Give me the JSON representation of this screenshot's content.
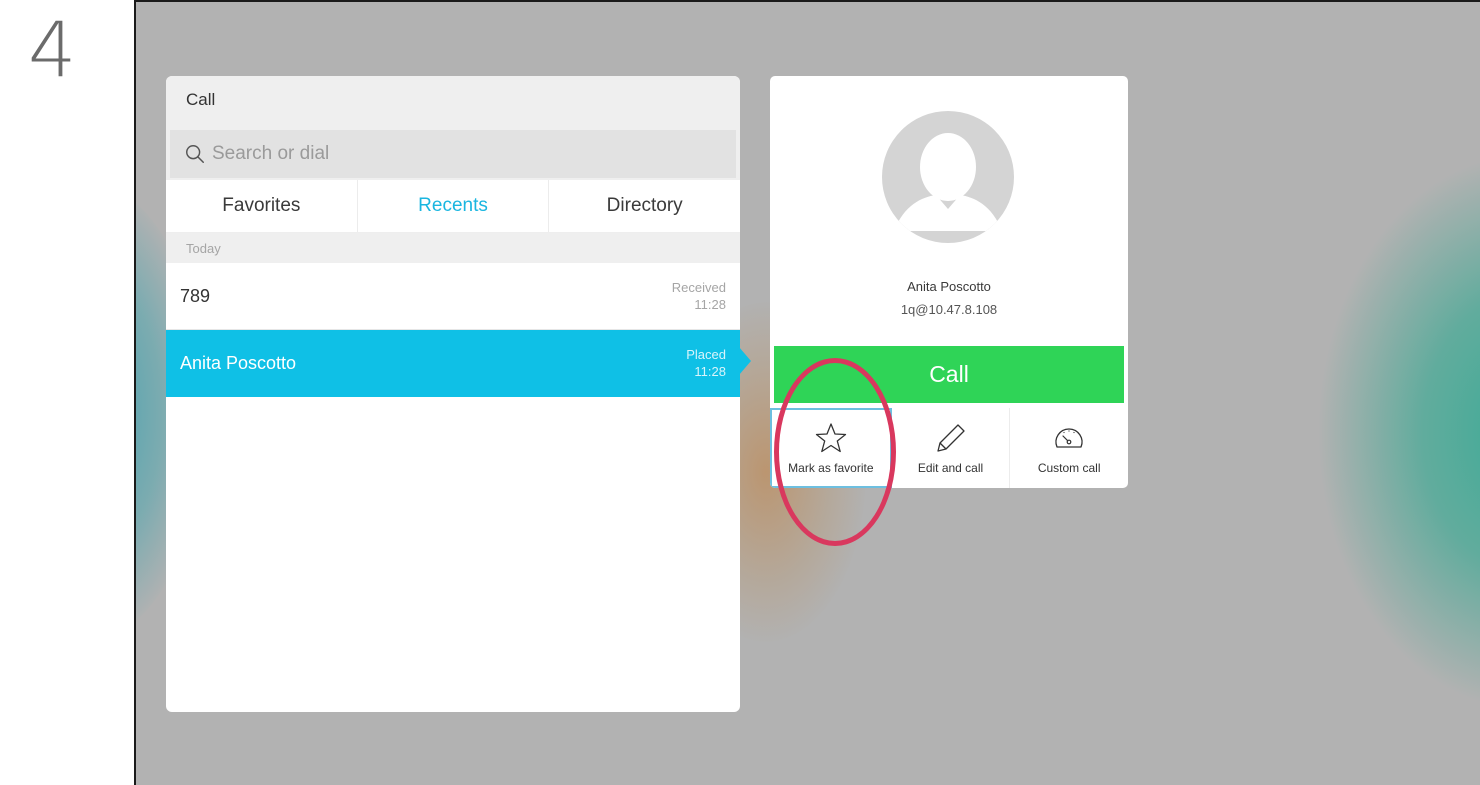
{
  "step": {
    "number": "4"
  },
  "call_panel": {
    "title": "Call",
    "search": {
      "placeholder": "Search or dial"
    },
    "tabs": [
      {
        "label": "Favorites",
        "active": false
      },
      {
        "label": "Recents",
        "active": true
      },
      {
        "label": "Directory",
        "active": false
      }
    ],
    "section": "Today",
    "recents": [
      {
        "name": "789",
        "status": "Received",
        "time": "11:28",
        "selected": false
      },
      {
        "name": "Anita Poscotto",
        "status": "Placed",
        "time": "11:28",
        "selected": true
      }
    ]
  },
  "contact_card": {
    "name": "Anita Poscotto",
    "address": "1q@10.47.8.108",
    "call_label": "Call",
    "actions": [
      {
        "label": "Mark as favorite",
        "icon": "star-icon"
      },
      {
        "label": "Edit and call",
        "icon": "pencil-icon"
      },
      {
        "label": "Custom call",
        "icon": "speedometer-icon"
      }
    ]
  },
  "colors": {
    "accent": "#0fc0e6",
    "call_green": "#2fd457",
    "highlight_ring": "#d9385e"
  }
}
